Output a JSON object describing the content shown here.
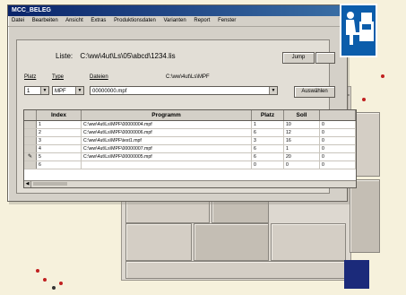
{
  "window": {
    "title": "MCC_BELEG"
  },
  "menu": [
    "Datei",
    "Bearbeiten",
    "Ansicht",
    "Extras",
    "Produktionsdaten",
    "Varianten",
    "Report",
    "Fenster"
  ],
  "liste": {
    "label": "Liste:",
    "path": "C:\\ww\\4ut\\Ls\\05\\abcd\\1234.lis",
    "jump_btn": "Jump"
  },
  "fields": {
    "platz": {
      "label": "Platz",
      "value": "1"
    },
    "type": {
      "label": "Type",
      "value": "MPF"
    },
    "dateien": {
      "label": "Dateien",
      "value": "00000000.mpf",
      "path": "C:\\ww\\4ut\\Ls\\MPF"
    },
    "auswahlen_btn": "Auswählen"
  },
  "table": {
    "columns": [
      "",
      "Index",
      "Programm",
      "Platz",
      "Soll",
      ""
    ],
    "rows": [
      {
        "mark": "",
        "index": "1",
        "programm": "C:\\ww\\4ut\\Ls\\MPF\\00000004.mpf",
        "platz": "1",
        "soll": "10",
        "extra": "0"
      },
      {
        "mark": "",
        "index": "2",
        "programm": "C:\\ww\\4ut\\Ls\\MPF\\00000006.mpf",
        "platz": "6",
        "soll": "12",
        "extra": "0"
      },
      {
        "mark": "",
        "index": "3",
        "programm": "C:\\ww\\4ut\\Ls\\MPF\\test1.mpf",
        "platz": "3",
        "soll": "16",
        "extra": "0"
      },
      {
        "mark": "",
        "index": "4",
        "programm": "C:\\ww\\4ut\\Ls\\MPF\\00000007.mpf",
        "platz": "6",
        "soll": "1",
        "extra": "0"
      },
      {
        "mark": "✎",
        "index": "5",
        "programm": "C:\\ww\\4ut\\Ls\\MPF\\00000005.mpf",
        "platz": "6",
        "soll": "20",
        "extra": "0"
      },
      {
        "mark": "",
        "index": "6",
        "programm": "",
        "platz": "0",
        "soll": "0",
        "extra": "0"
      }
    ]
  },
  "colors": {
    "accent": "#0c5dab",
    "titlebar": "#0a246a"
  },
  "icons": [
    "operator-terminal-icon"
  ]
}
